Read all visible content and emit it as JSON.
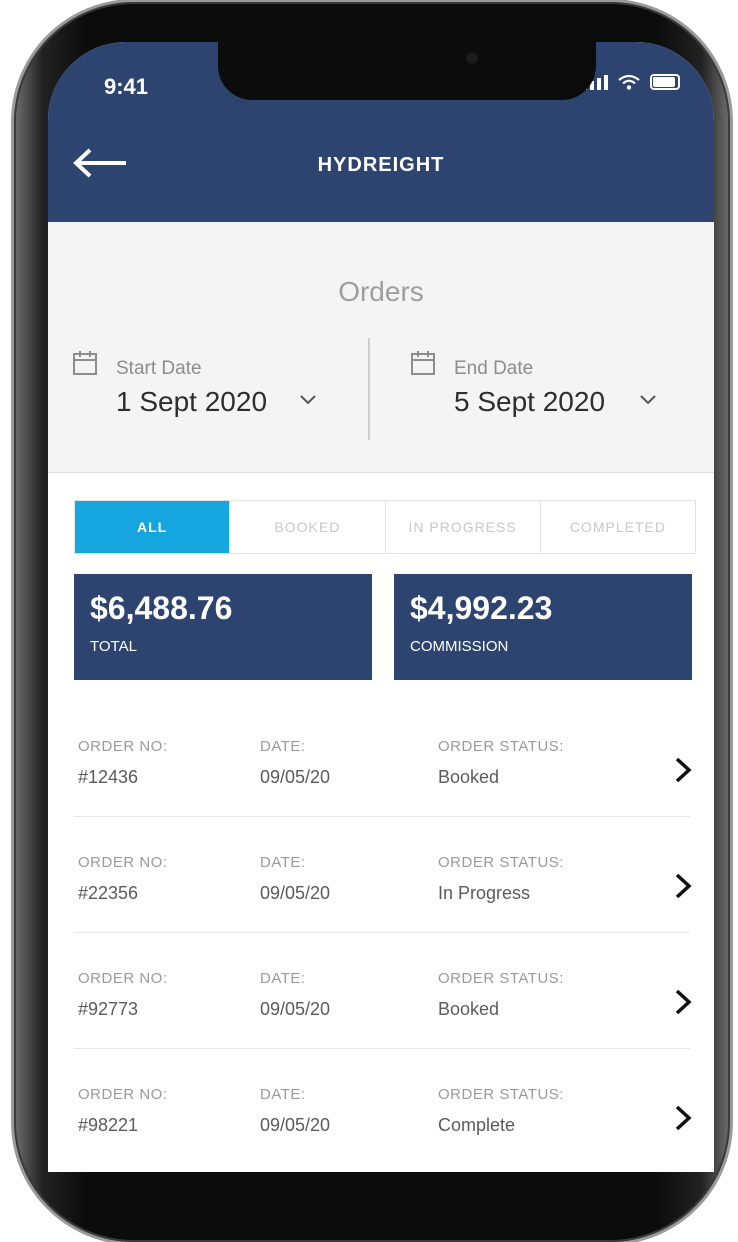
{
  "status_bar": {
    "time": "9:41"
  },
  "header": {
    "back_icon": "arrow-left-icon",
    "logo": "HYDREIGHT"
  },
  "page": {
    "title": "Orders"
  },
  "filters": {
    "start": {
      "label": "Start Date",
      "value": "1 Sept 2020"
    },
    "end": {
      "label": "End Date",
      "value": "5 Sept 2020"
    }
  },
  "tabs": [
    {
      "label": "ALL",
      "active": true
    },
    {
      "label": "BOOKED",
      "active": false
    },
    {
      "label": "IN PROGRESS",
      "active": false
    },
    {
      "label": "COMPLETED",
      "active": false
    }
  ],
  "summary": {
    "total": {
      "amount": "$6,488.76",
      "caption": "TOTAL"
    },
    "commission": {
      "amount": "$4,992.23",
      "caption": "COMMISSION"
    }
  },
  "orders_labels": {
    "order_no": "ORDER NO:",
    "date": "DATE:",
    "status": "ORDER STATUS:"
  },
  "orders": [
    {
      "order_no": "#12436",
      "date": "09/05/20",
      "status": "Booked"
    },
    {
      "order_no": "#22356",
      "date": "09/05/20",
      "status": "In Progress"
    },
    {
      "order_no": "#92773",
      "date": "09/05/20",
      "status": "Booked"
    },
    {
      "order_no": "#98221",
      "date": "09/05/20",
      "status": "Complete"
    }
  ],
  "colors": {
    "navy": "#2e4470",
    "accent": "#15a6e0",
    "background": "#f4f4f4"
  }
}
